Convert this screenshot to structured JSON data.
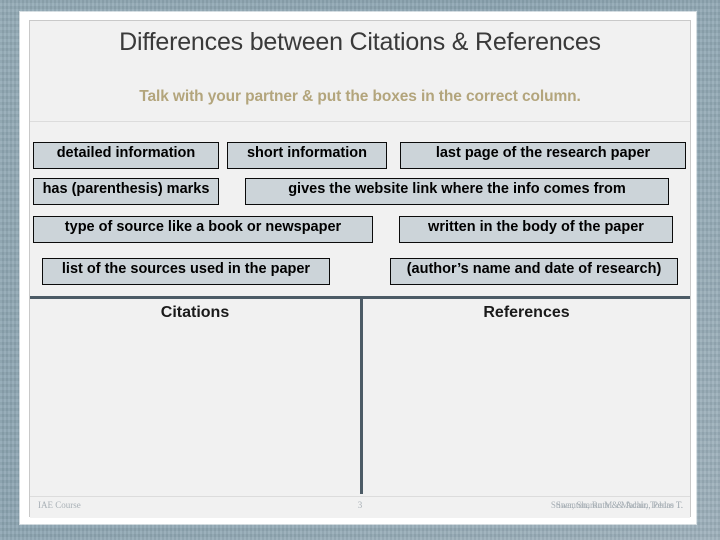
{
  "slide": {
    "title": "Differences between Citations & References",
    "subtitle": "Talk with your partner & put the boxes in the correct column.",
    "colors": {
      "outer_background": "#8ba4b1",
      "slide_background": "#f1f1f1",
      "box_fill": "#ccd4d9",
      "box_border": "#0b0b0b",
      "subtitle_text": "#b3a57c",
      "title_text": "#3a3a3a",
      "rule": "#4c5b66",
      "footer_text": "#a8b0b6"
    }
  },
  "answer_boxes": [
    {
      "id": "detailed-information",
      "text": "detailed information"
    },
    {
      "id": "short-information",
      "text": "short information"
    },
    {
      "id": "last-page",
      "text": "last page of the research paper"
    },
    {
      "id": "parenthesis-marks",
      "text": "has (parenthesis) marks"
    },
    {
      "id": "website-link",
      "text": "gives the website link where the info comes from"
    },
    {
      "id": "type-of-source",
      "text": "type of source like a book or newspaper"
    },
    {
      "id": "written-in-body",
      "text": "written in the body of the paper"
    },
    {
      "id": "list-of-sources",
      "text": "list of the sources used in the paper"
    },
    {
      "id": "author-name-date",
      "text": "(author’s name and date of research)"
    }
  ],
  "columns": [
    {
      "id": "citations",
      "heading": "Citations"
    },
    {
      "id": "references",
      "heading": "References"
    }
  ],
  "footer": {
    "left": "IAE Course",
    "page_number": "3",
    "right_primary": "Stiner, Sharon M. & Adair, Tobias T.",
    "right_overlap": "Swanton, Ruth & Machin, Pedro T."
  }
}
